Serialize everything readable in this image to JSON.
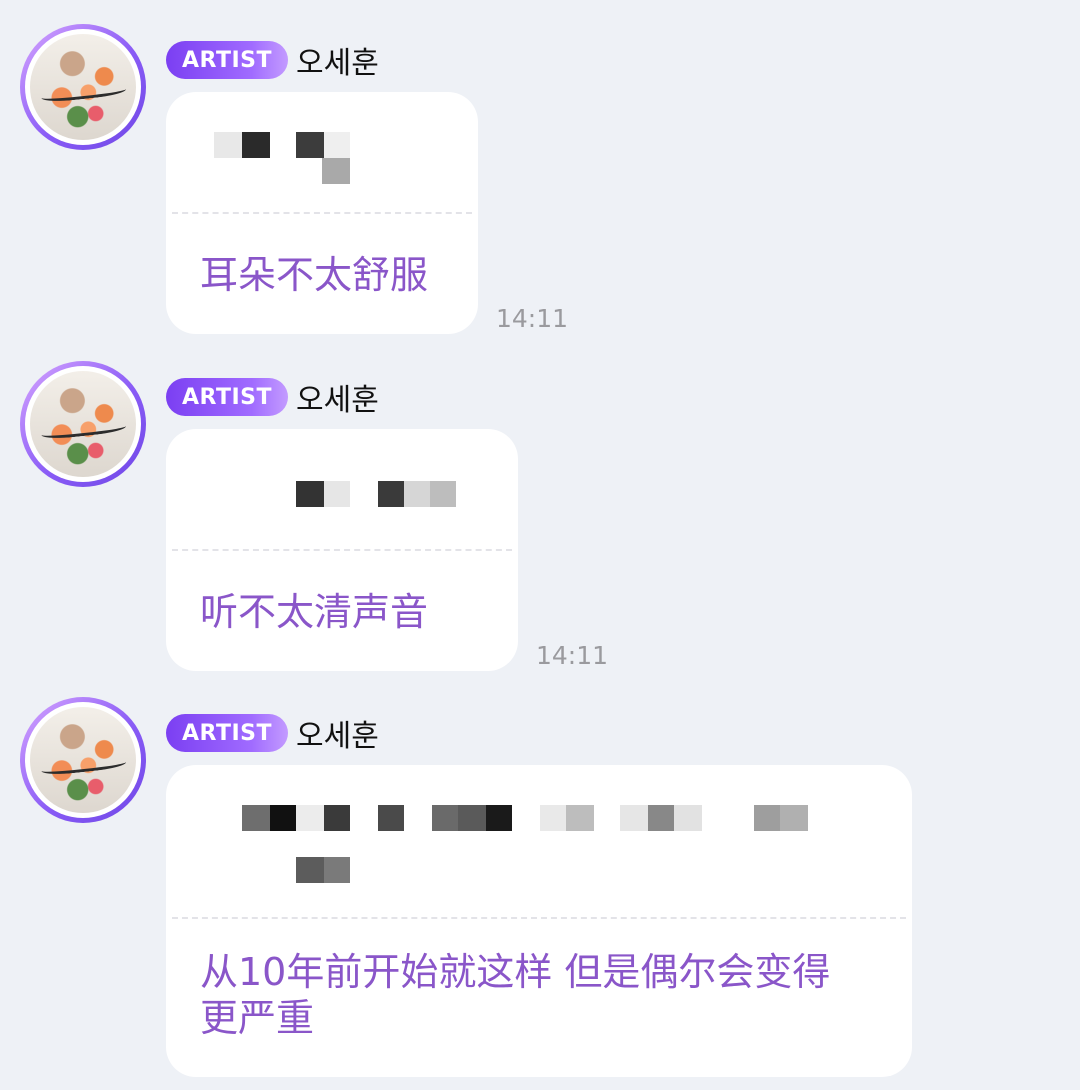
{
  "messages": [
    {
      "badge": "ARTIST",
      "sender": "오세훈",
      "text": "耳朵不太舒服",
      "time": "14:11"
    },
    {
      "badge": "ARTIST",
      "sender": "오세훈",
      "text": "听不太清声音",
      "time": "14:11"
    },
    {
      "badge": "ARTIST",
      "sender": "오세훈",
      "text": "从10年前开始就这样 但是偶尔会变得\n更严重",
      "time": ""
    }
  ],
  "colors": {
    "background": "#eef1f6",
    "badge_gradient_start": "#7b3ff2",
    "translation_text": "#8a56c9",
    "time": "#9a9a9e"
  },
  "icons": {
    "avatar": "bouquet-photo-avatar"
  }
}
